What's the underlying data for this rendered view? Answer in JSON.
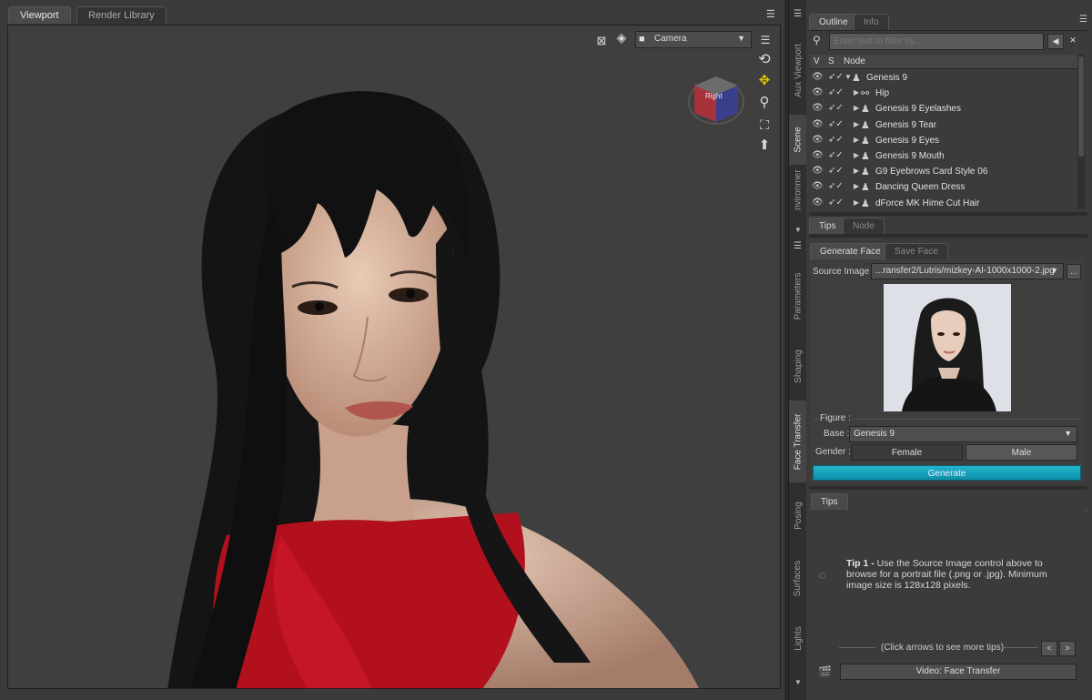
{
  "viewport": {
    "tabs": [
      {
        "label": "Viewport"
      },
      {
        "label": "Render Library"
      }
    ],
    "camera_label": "Camera",
    "cube_label": "Right"
  },
  "side_tabs": {
    "top": [
      {
        "label": "Aux Viewport"
      },
      {
        "label": "Scene"
      },
      {
        "label": "Environment"
      }
    ],
    "bottom": [
      {
        "label": "Parameters"
      },
      {
        "label": "Shaping"
      },
      {
        "label": "Face Transfer"
      },
      {
        "label": "Posing"
      },
      {
        "label": "Surfaces"
      },
      {
        "label": "Lights"
      }
    ]
  },
  "scene": {
    "tabs": [
      {
        "label": "Outline"
      },
      {
        "label": "Info"
      }
    ],
    "filter_placeholder": "Enter text to filter by...",
    "columns": {
      "v": "V",
      "s": "S",
      "node": "Node"
    },
    "nodes": [
      {
        "label": "Genesis 9",
        "icon": "figure-icon"
      },
      {
        "label": "Hip",
        "icon": "bone-icon"
      },
      {
        "label": "Genesis 9 Eyelashes",
        "icon": "figure-icon"
      },
      {
        "label": "Genesis 9 Tear",
        "icon": "figure-icon"
      },
      {
        "label": "Genesis 9 Eyes",
        "icon": "figure-icon"
      },
      {
        "label": "Genesis 9 Mouth",
        "icon": "figure-icon"
      },
      {
        "label": "G9 Eyebrows Card Style 06",
        "icon": "figure-icon"
      },
      {
        "label": "Dancing Queen Dress",
        "icon": "figure-icon"
      },
      {
        "label": "dForce MK Hime Cut Hair",
        "icon": "figure-icon"
      }
    ]
  },
  "mid_tabs": [
    {
      "label": "Tips"
    },
    {
      "label": "Node"
    }
  ],
  "face_transfer": {
    "tabs": [
      {
        "label": "Generate Face"
      },
      {
        "label": "Save Face"
      }
    ],
    "source_label": "Source Image :",
    "source_value": "...ransfer2/Lutris/mizkey-AI-1000x1000-2.jpg",
    "source_more": "...",
    "figure_label": "Figure :",
    "base_label": "Base :",
    "base_value": "Genesis 9",
    "gender_label": "Gender :",
    "gender_options": [
      "Female",
      "Male"
    ],
    "generate_label": "Generate"
  },
  "tips": {
    "tab": "Tips",
    "tip_title": "Tip 1 -",
    "tip_body": "Use the Source Image control above to browse for a portrait file (.png or .jpg). Minimum image size is 128x128 pixels.",
    "nav_hint": "(Click arrows to see more tips)",
    "video_label": "Video: Face Transfer"
  },
  "colors": {
    "accent": "#14a3bc",
    "panel": "#3b3b3b",
    "viewport": "#3f3f3f"
  }
}
